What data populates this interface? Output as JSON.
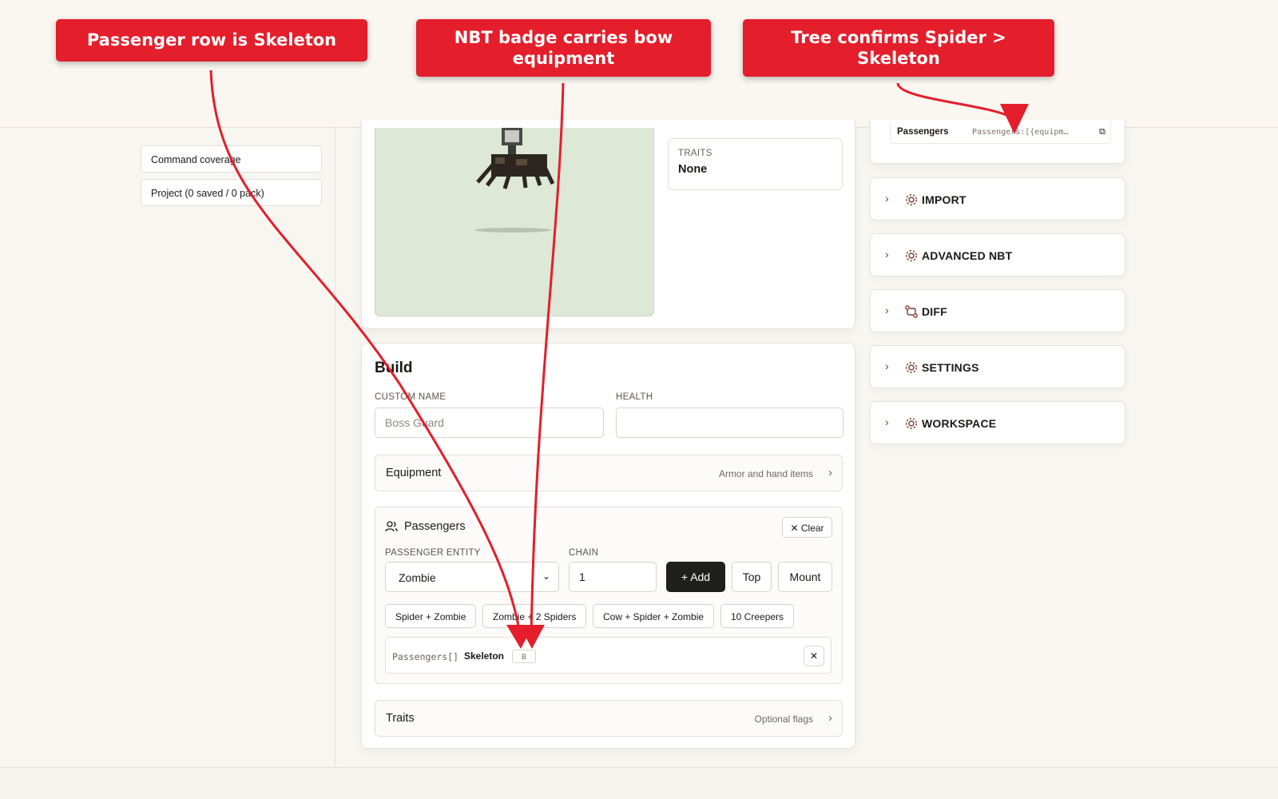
{
  "sidebar": {
    "items": [
      {
        "label": "Command coverage"
      },
      {
        "label": "Project (0 saved / 0 pack)"
      }
    ]
  },
  "preview": {
    "traits_label": "TRAITS",
    "traits_value": "None"
  },
  "build": {
    "title": "Build",
    "custom_name_label": "CUSTOM NAME",
    "custom_name_placeholder": "Boss Guard",
    "health_label": "HEALTH",
    "health_value": "",
    "equipment": {
      "title": "Equipment",
      "hint": "Armor and hand items"
    },
    "passengers": {
      "title": "Passengers",
      "clear_label": "Clear",
      "entity_label": "PASSENGER ENTITY",
      "entity_value": "Zombie",
      "chain_label": "CHAIN",
      "chain_value": "1",
      "add_label": "Add",
      "top_label": "Top",
      "mount_label": "Mount",
      "presets": [
        "Spider + Zombie",
        "Zombie + 2 Spiders",
        "Cow + Spider + Zombie",
        "10 Creepers"
      ],
      "row": {
        "path": "Passengers[]",
        "name": "Skeleton",
        "badge": "B"
      }
    },
    "traits": {
      "title": "Traits",
      "hint": "Optional flags"
    }
  },
  "right_panel": {
    "tree_row": {
      "key": "Passengers",
      "value": "Passengers:[{equipm…"
    },
    "sections": [
      {
        "label": "IMPORT",
        "icon": "gear-icon"
      },
      {
        "label": "ADVANCED NBT",
        "icon": "gear-icon"
      },
      {
        "label": "DIFF",
        "icon": "git-compare-icon"
      },
      {
        "label": "SETTINGS",
        "icon": "gear-icon"
      },
      {
        "label": "WORKSPACE",
        "icon": "gear-icon"
      }
    ]
  },
  "annotations": [
    {
      "text": "Passenger row is Skeleton"
    },
    {
      "text": "NBT badge carries bow equipment"
    },
    {
      "text": "Tree confirms Spider > Skeleton"
    }
  ],
  "colors": {
    "callout": "#e41e2b",
    "accent_icon": "#7a3b2a",
    "dark_button": "#1f1f1c",
    "background": "#f8f6f1"
  }
}
